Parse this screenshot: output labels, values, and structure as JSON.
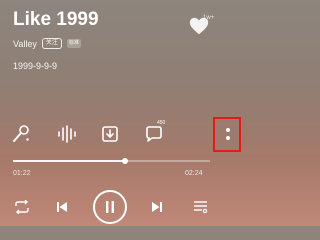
{
  "song": {
    "title": "Like 1999",
    "artist": "Valley",
    "follow_label": "关注",
    "quality_label": "标准",
    "lyric": "1999-9-9-9"
  },
  "like": {
    "count": "1w+",
    "icon": "heart-icon"
  },
  "toolbar": {
    "items": [
      {
        "icon": "singing-mic-icon"
      },
      {
        "icon": "sound-effect-icon"
      },
      {
        "icon": "download-icon"
      },
      {
        "icon": "comment-icon",
        "badge": "450"
      },
      {
        "icon": "more-vertical-icon"
      }
    ]
  },
  "progress": {
    "elapsed": "01:22",
    "duration": "02:24",
    "fraction": 0.57
  },
  "controls": {
    "items": [
      "repeat-icon",
      "previous-icon",
      "pause-icon",
      "next-icon",
      "playlist-icon"
    ]
  }
}
